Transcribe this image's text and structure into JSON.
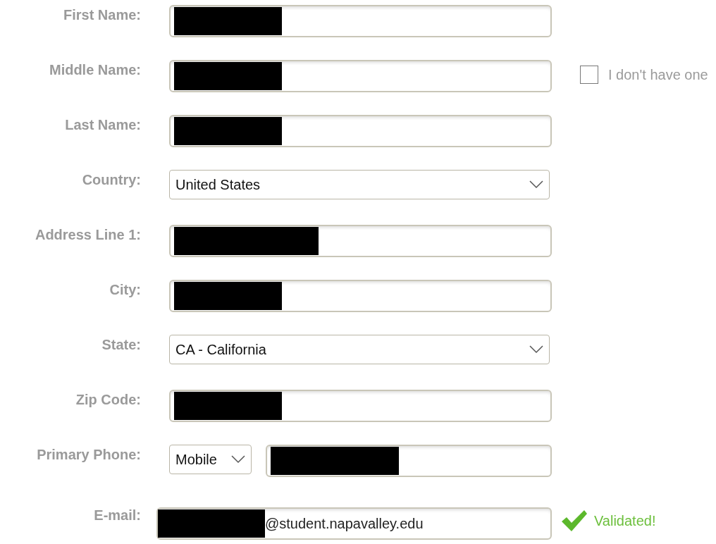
{
  "fields": [
    {
      "kind": "text",
      "label": "First Name:",
      "redacted": true
    },
    {
      "kind": "text",
      "label": "Middle Name:",
      "redacted": true,
      "option": {
        "label": "I don't have one",
        "checked": false
      }
    },
    {
      "kind": "text",
      "label": "Last Name:",
      "redacted": true
    },
    {
      "kind": "select",
      "label": "Country:",
      "value": "United States"
    },
    {
      "kind": "text",
      "label": "Address Line 1:",
      "redacted": true
    },
    {
      "kind": "text",
      "label": "City:",
      "redacted": true
    },
    {
      "kind": "select",
      "label": "State:",
      "value": "CA - California"
    },
    {
      "kind": "text",
      "label": "Zip Code:",
      "redacted": true
    },
    {
      "kind": "phone",
      "label": "Primary Phone:",
      "phone_type": "Mobile",
      "redacted": true
    },
    {
      "kind": "email",
      "label": "E-mail:",
      "redacted": true,
      "value": "@student.napavalley.edu",
      "status": "Validated!"
    }
  ]
}
